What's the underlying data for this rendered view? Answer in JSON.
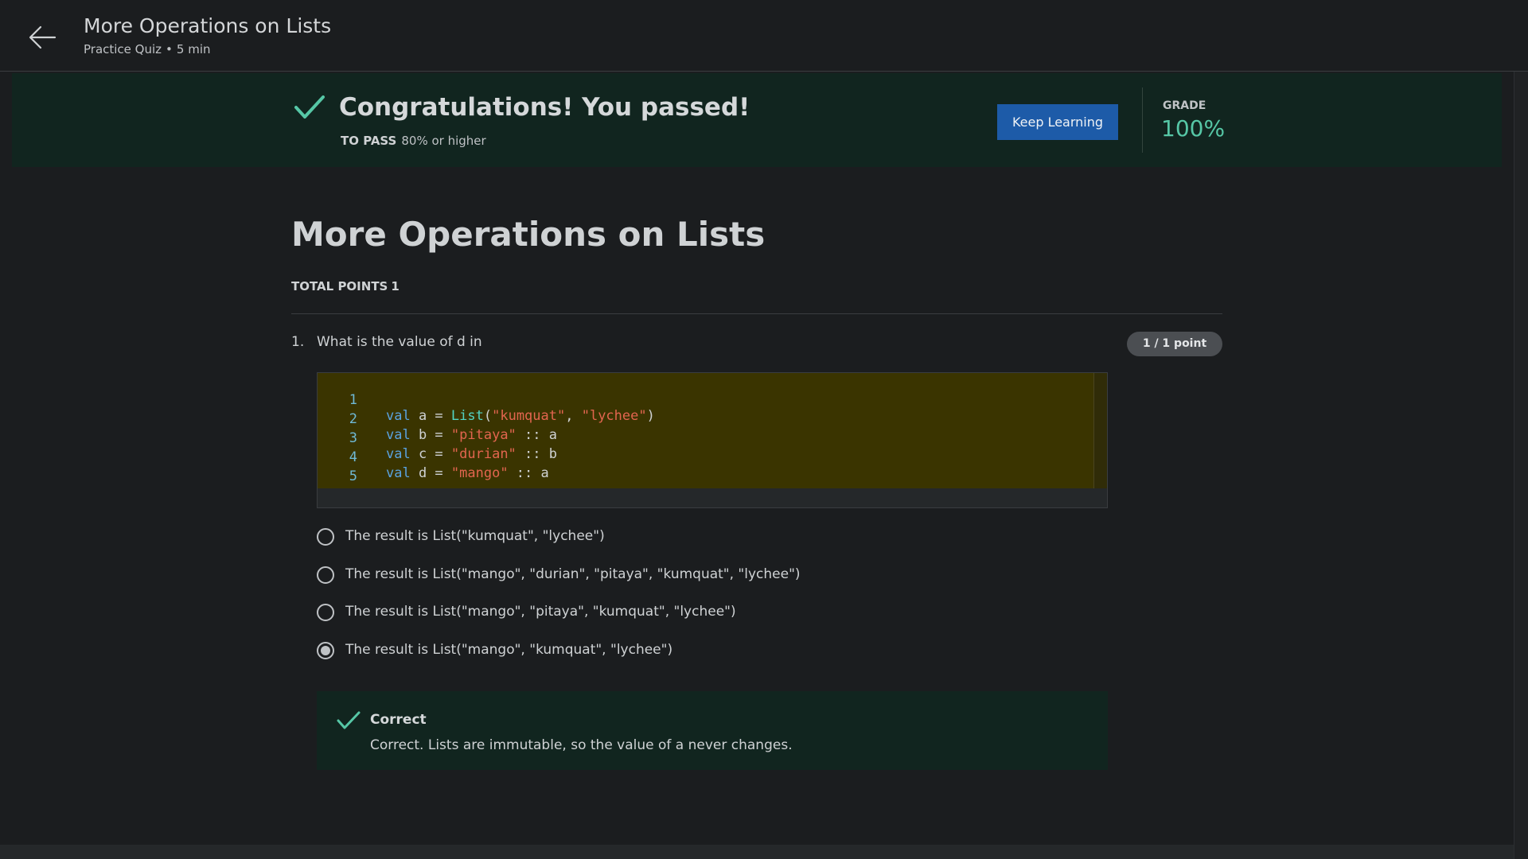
{
  "header": {
    "title": "More Operations on Lists",
    "type": "Practice Quiz",
    "separator": "•",
    "duration": "5 min",
    "back_icon": "arrow-left-icon"
  },
  "banner": {
    "check_icon": "check-icon",
    "title": "Congratulations! You passed!",
    "pass_label": "TO PASS",
    "pass_value": "80% or higher",
    "keep_learning_label": "Keep Learning",
    "grade_label": "GRADE",
    "grade_value": "100%"
  },
  "quiz": {
    "title": "More Operations on Lists",
    "total_points_label": "TOTAL POINTS",
    "total_points_value": "1"
  },
  "question": {
    "number": "1.",
    "text": "What is the value of d in",
    "points_badge": "1 / 1 point",
    "code_lines": [
      {
        "n": "1",
        "kw": "val",
        "rest_a": " a = ",
        "fn": "List",
        "p1": "(",
        "s1": "\"kumquat\"",
        "p2": ", ",
        "s2": "\"lychee\"",
        "p3": ")"
      },
      {
        "n": "2",
        "kw": "val",
        "rest_a": " b = ",
        "s1": "\"pitaya\"",
        "p3": " :: a"
      },
      {
        "n": "3",
        "kw": "val",
        "rest_a": " c = ",
        "s1": "\"durian\"",
        "p3": " :: b"
      },
      {
        "n": "4",
        "kw": "val",
        "rest_a": " d = ",
        "s1": "\"mango\"",
        "p3": " :: a"
      },
      {
        "n": "5"
      }
    ],
    "options": [
      {
        "text": "The result is List(\"kumquat\", \"lychee\")",
        "selected": false
      },
      {
        "text": "The result is List(\"mango\", \"durian\", \"pitaya\", \"kumquat\", \"lychee\")",
        "selected": false
      },
      {
        "text": "The result is List(\"mango\", \"pitaya\", \"kumquat\", \"lychee\")",
        "selected": false
      },
      {
        "text": "The result is List(\"mango\", \"kumquat\", \"lychee\")",
        "selected": true
      }
    ],
    "feedback": {
      "icon": "check-icon",
      "title": "Correct",
      "text": "Correct. Lists are immutable, so the value of a never changes."
    }
  },
  "colors": {
    "background": "#1b1d1f",
    "banner": "#11251f",
    "accent_green": "#56c7a6",
    "button_blue": "#1d5ba8",
    "code_bg": "#3a3400",
    "keyword": "#5aa3e0",
    "string": "#e2654f"
  }
}
